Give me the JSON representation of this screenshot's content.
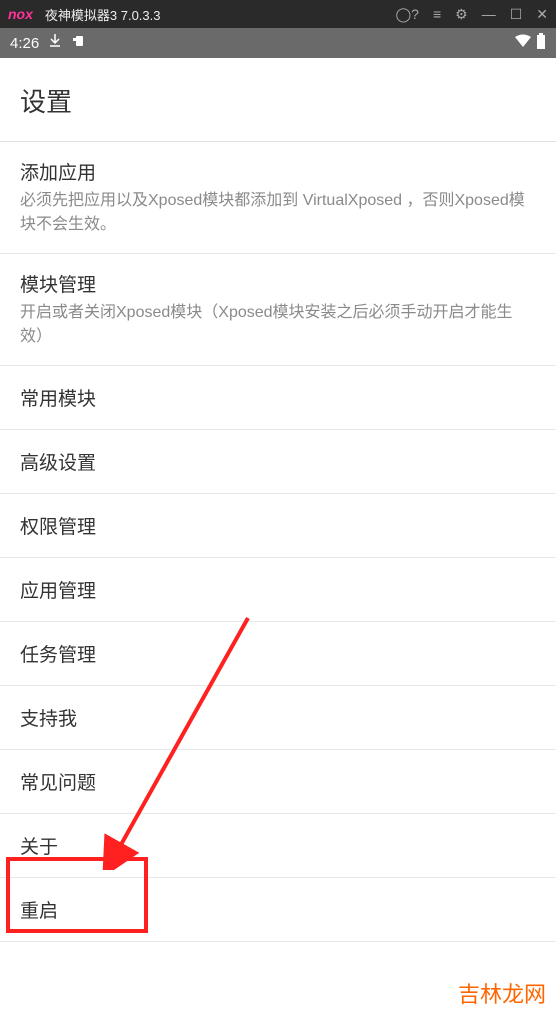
{
  "emulator": {
    "logo": "nox",
    "title": "夜神模拟器3 7.0.3.3"
  },
  "statusBar": {
    "time": "4:26"
  },
  "page": {
    "title": "设置"
  },
  "settings": {
    "items": [
      {
        "title": "添加应用",
        "desc": "必须先把应用以及Xposed模块都添加到 VirtualXposed ，否则Xposed模块不会生效。"
      },
      {
        "title": "模块管理",
        "desc": "开启或者关闭Xposed模块（Xposed模块安装之后必须手动开启才能生效）"
      },
      {
        "title": "常用模块",
        "desc": ""
      },
      {
        "title": "高级设置",
        "desc": ""
      },
      {
        "title": "权限管理",
        "desc": ""
      },
      {
        "title": "应用管理",
        "desc": ""
      },
      {
        "title": "任务管理",
        "desc": ""
      },
      {
        "title": "支持我",
        "desc": ""
      },
      {
        "title": "常见问题",
        "desc": ""
      },
      {
        "title": "关于",
        "desc": ""
      },
      {
        "title": "重启",
        "desc": ""
      }
    ]
  },
  "watermark": "吉林龙网",
  "annotation": {
    "highlightIndex": 10
  }
}
